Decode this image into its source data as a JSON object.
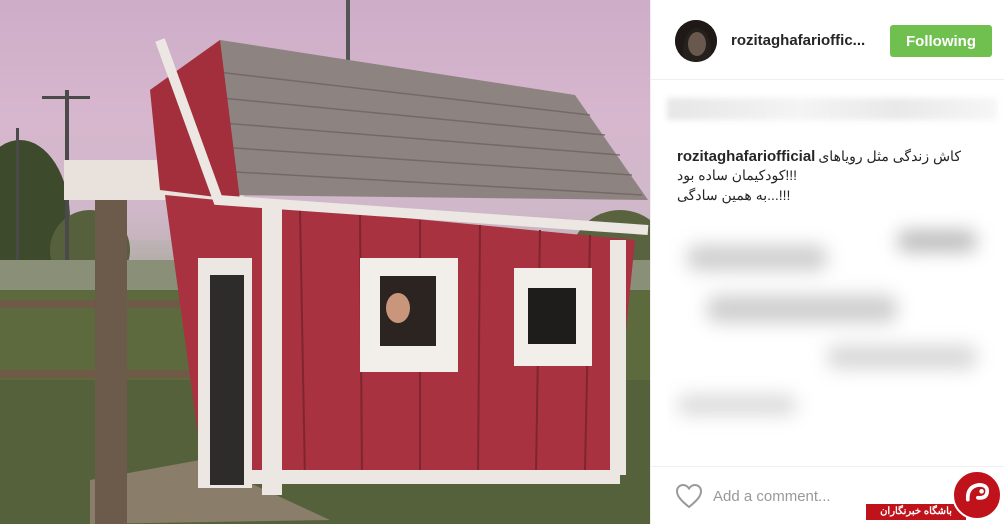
{
  "post": {
    "username": "rozitaghafarioffic...",
    "follow_label": "Following",
    "caption_username": "rozitaghafariofficial",
    "caption_line1": "کاش زندگی مثل رویاهای",
    "caption_line2": "!!!کودکیمان ساده بود",
    "caption_line3": "!!!...به همین سادگی",
    "comment_placeholder": "Add a comment..."
  },
  "watermark": {
    "label": "باشگاه خبرنگاران"
  },
  "colors": {
    "follow_green": "#70c050",
    "watermark_red": "#c0121b"
  },
  "icons": [
    "heart-icon",
    "watermark-logo-icon"
  ]
}
